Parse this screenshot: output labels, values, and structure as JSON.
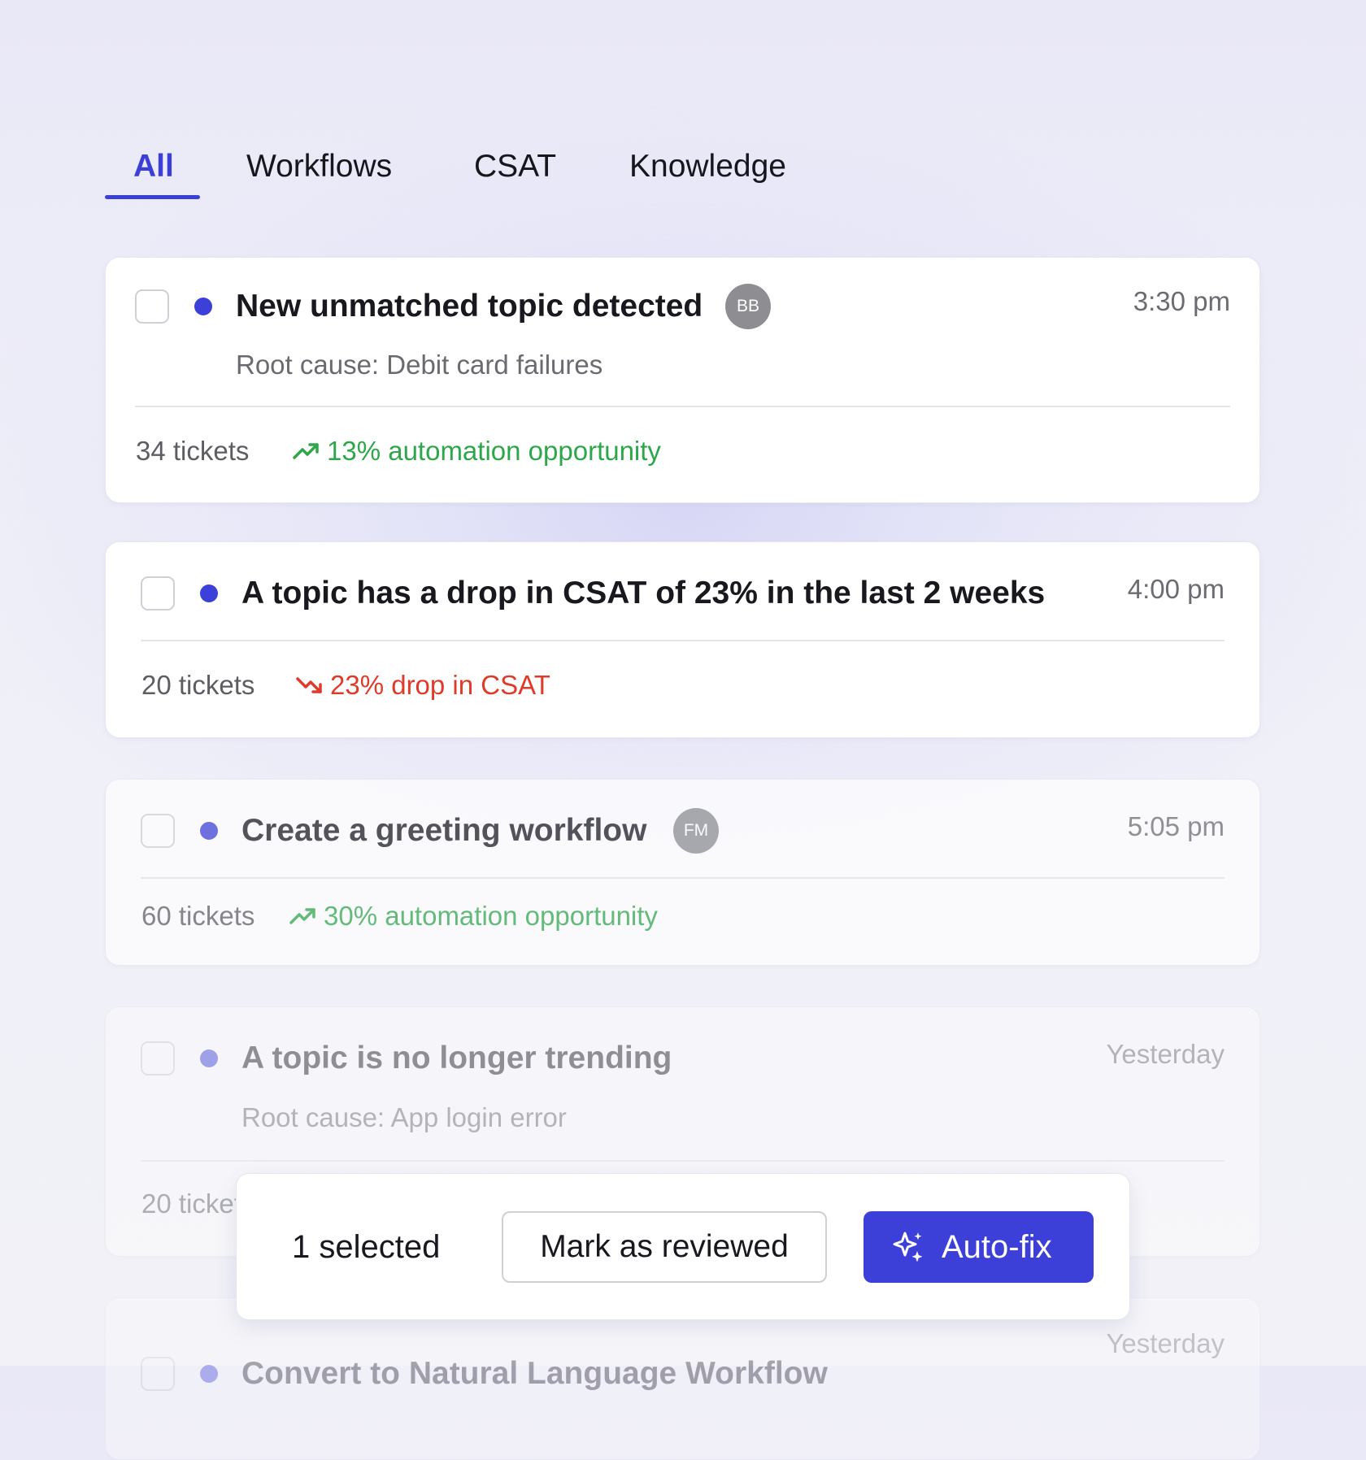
{
  "tabs": [
    {
      "label": "All",
      "active": true
    },
    {
      "label": "Workflows",
      "active": false
    },
    {
      "label": "CSAT",
      "active": false
    },
    {
      "label": "Knowledge",
      "active": false
    }
  ],
  "colors": {
    "accent": "#3d40d8",
    "positive": "#2ea64a",
    "negative": "#df3b2a"
  },
  "cards": [
    {
      "title": "New unmatched topic detected",
      "avatar": "BB",
      "time": "3:30 pm",
      "subtitle": "Root cause: Debit card failures",
      "tickets": "34 tickets",
      "trend_icon": "trend-up-icon",
      "trend": "13% automation opportunity"
    },
    {
      "title": "A topic has a drop in CSAT of 23% in the last 2 weeks",
      "time": "4:00 pm",
      "tickets": "20 tickets",
      "trend_icon": "trend-down-icon",
      "trend": "23% drop in CSAT"
    },
    {
      "title": "Create a greeting workflow",
      "avatar": "FM",
      "time": "5:05 pm",
      "tickets": "60 tickets",
      "trend_icon": "trend-up-icon",
      "trend": "30% automation opportunity"
    },
    {
      "title": "A topic is no longer trending",
      "time": "Yesterday",
      "subtitle": "Root cause: App login error",
      "tickets": "20 tickets"
    },
    {
      "title": "Convert to Natural Language Workflow",
      "time": "Yesterday"
    }
  ],
  "actionbar": {
    "selected": "1 selected",
    "review_label": "Mark as reviewed",
    "autofix_icon": "sparkle-icon",
    "autofix_label": "Auto-fix"
  }
}
